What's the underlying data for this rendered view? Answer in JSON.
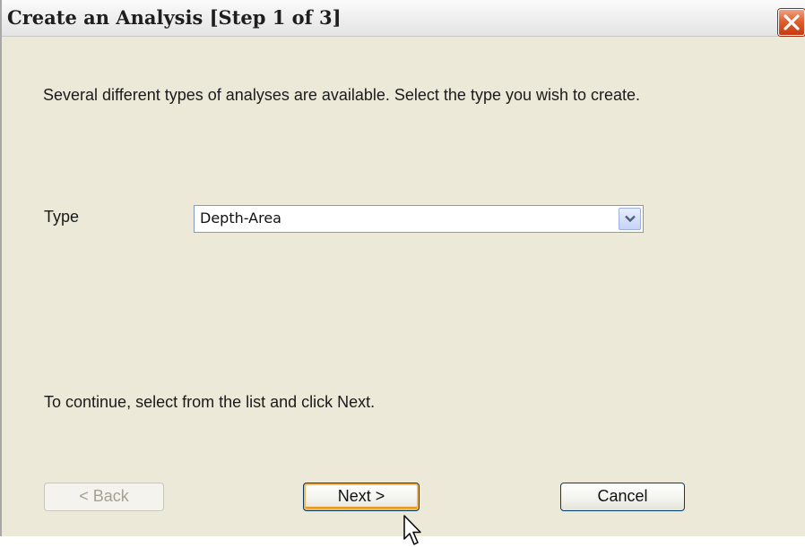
{
  "window": {
    "title": "Create an Analysis [Step 1 of 3]"
  },
  "content": {
    "intro": "Several different types of analyses are available. Select the type you wish to create.",
    "type_label": "Type",
    "type_value": "Depth-Area",
    "instructions": "To continue, select from the list and click Next."
  },
  "buttons": {
    "back": "< Back",
    "next": "Next >",
    "cancel": "Cancel"
  },
  "icons": {
    "close": "close-icon",
    "dropdown": "chevron-down-icon",
    "cursor": "mouse-pointer-icon"
  },
  "colors": {
    "dialog_bg": "#ece9d8",
    "close_button": "#e06030",
    "next_focus_ring": "#f8b74a",
    "button_border": "#003c74"
  }
}
